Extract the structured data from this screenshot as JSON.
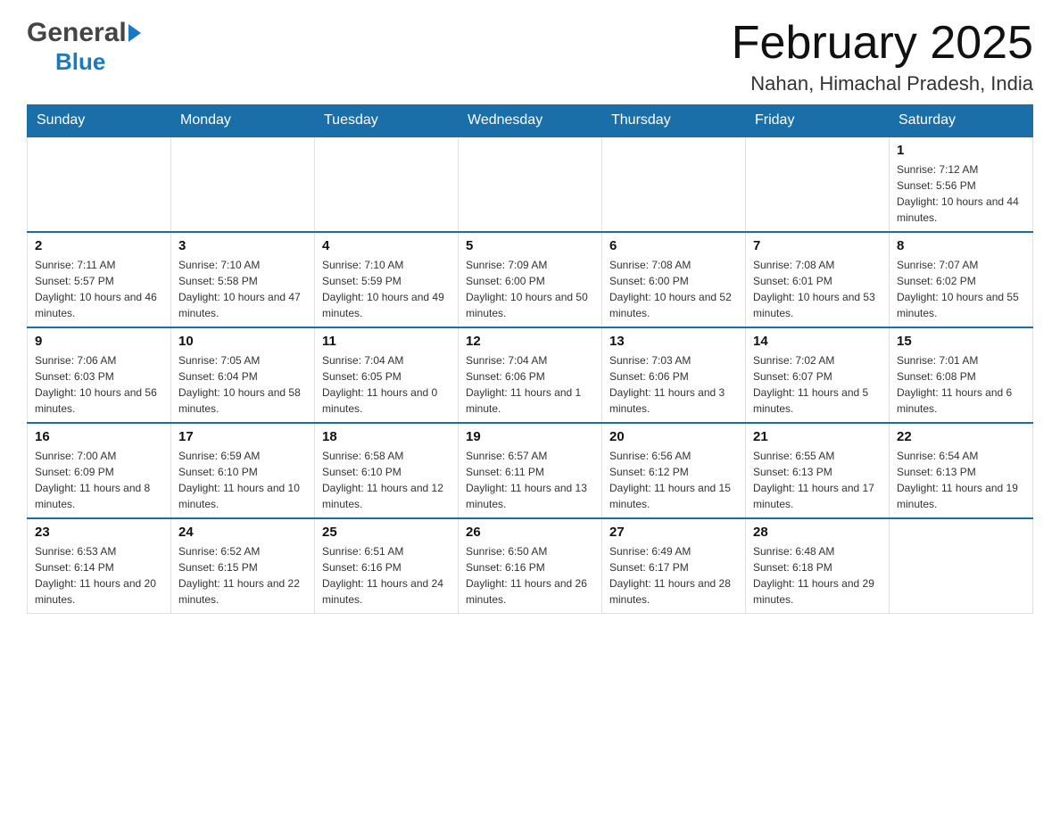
{
  "header": {
    "logo_general": "General",
    "logo_blue": "Blue",
    "month_title": "February 2025",
    "location": "Nahan, Himachal Pradesh, India"
  },
  "days_of_week": [
    "Sunday",
    "Monday",
    "Tuesday",
    "Wednesday",
    "Thursday",
    "Friday",
    "Saturday"
  ],
  "weeks": [
    [
      {
        "day": "",
        "info": ""
      },
      {
        "day": "",
        "info": ""
      },
      {
        "day": "",
        "info": ""
      },
      {
        "day": "",
        "info": ""
      },
      {
        "day": "",
        "info": ""
      },
      {
        "day": "",
        "info": ""
      },
      {
        "day": "1",
        "info": "Sunrise: 7:12 AM\nSunset: 5:56 PM\nDaylight: 10 hours and 44 minutes."
      }
    ],
    [
      {
        "day": "2",
        "info": "Sunrise: 7:11 AM\nSunset: 5:57 PM\nDaylight: 10 hours and 46 minutes."
      },
      {
        "day": "3",
        "info": "Sunrise: 7:10 AM\nSunset: 5:58 PM\nDaylight: 10 hours and 47 minutes."
      },
      {
        "day": "4",
        "info": "Sunrise: 7:10 AM\nSunset: 5:59 PM\nDaylight: 10 hours and 49 minutes."
      },
      {
        "day": "5",
        "info": "Sunrise: 7:09 AM\nSunset: 6:00 PM\nDaylight: 10 hours and 50 minutes."
      },
      {
        "day": "6",
        "info": "Sunrise: 7:08 AM\nSunset: 6:00 PM\nDaylight: 10 hours and 52 minutes."
      },
      {
        "day": "7",
        "info": "Sunrise: 7:08 AM\nSunset: 6:01 PM\nDaylight: 10 hours and 53 minutes."
      },
      {
        "day": "8",
        "info": "Sunrise: 7:07 AM\nSunset: 6:02 PM\nDaylight: 10 hours and 55 minutes."
      }
    ],
    [
      {
        "day": "9",
        "info": "Sunrise: 7:06 AM\nSunset: 6:03 PM\nDaylight: 10 hours and 56 minutes."
      },
      {
        "day": "10",
        "info": "Sunrise: 7:05 AM\nSunset: 6:04 PM\nDaylight: 10 hours and 58 minutes."
      },
      {
        "day": "11",
        "info": "Sunrise: 7:04 AM\nSunset: 6:05 PM\nDaylight: 11 hours and 0 minutes."
      },
      {
        "day": "12",
        "info": "Sunrise: 7:04 AM\nSunset: 6:06 PM\nDaylight: 11 hours and 1 minute."
      },
      {
        "day": "13",
        "info": "Sunrise: 7:03 AM\nSunset: 6:06 PM\nDaylight: 11 hours and 3 minutes."
      },
      {
        "day": "14",
        "info": "Sunrise: 7:02 AM\nSunset: 6:07 PM\nDaylight: 11 hours and 5 minutes."
      },
      {
        "day": "15",
        "info": "Sunrise: 7:01 AM\nSunset: 6:08 PM\nDaylight: 11 hours and 6 minutes."
      }
    ],
    [
      {
        "day": "16",
        "info": "Sunrise: 7:00 AM\nSunset: 6:09 PM\nDaylight: 11 hours and 8 minutes."
      },
      {
        "day": "17",
        "info": "Sunrise: 6:59 AM\nSunset: 6:10 PM\nDaylight: 11 hours and 10 minutes."
      },
      {
        "day": "18",
        "info": "Sunrise: 6:58 AM\nSunset: 6:10 PM\nDaylight: 11 hours and 12 minutes."
      },
      {
        "day": "19",
        "info": "Sunrise: 6:57 AM\nSunset: 6:11 PM\nDaylight: 11 hours and 13 minutes."
      },
      {
        "day": "20",
        "info": "Sunrise: 6:56 AM\nSunset: 6:12 PM\nDaylight: 11 hours and 15 minutes."
      },
      {
        "day": "21",
        "info": "Sunrise: 6:55 AM\nSunset: 6:13 PM\nDaylight: 11 hours and 17 minutes."
      },
      {
        "day": "22",
        "info": "Sunrise: 6:54 AM\nSunset: 6:13 PM\nDaylight: 11 hours and 19 minutes."
      }
    ],
    [
      {
        "day": "23",
        "info": "Sunrise: 6:53 AM\nSunset: 6:14 PM\nDaylight: 11 hours and 20 minutes."
      },
      {
        "day": "24",
        "info": "Sunrise: 6:52 AM\nSunset: 6:15 PM\nDaylight: 11 hours and 22 minutes."
      },
      {
        "day": "25",
        "info": "Sunrise: 6:51 AM\nSunset: 6:16 PM\nDaylight: 11 hours and 24 minutes."
      },
      {
        "day": "26",
        "info": "Sunrise: 6:50 AM\nSunset: 6:16 PM\nDaylight: 11 hours and 26 minutes."
      },
      {
        "day": "27",
        "info": "Sunrise: 6:49 AM\nSunset: 6:17 PM\nDaylight: 11 hours and 28 minutes."
      },
      {
        "day": "28",
        "info": "Sunrise: 6:48 AM\nSunset: 6:18 PM\nDaylight: 11 hours and 29 minutes."
      },
      {
        "day": "",
        "info": ""
      }
    ]
  ]
}
